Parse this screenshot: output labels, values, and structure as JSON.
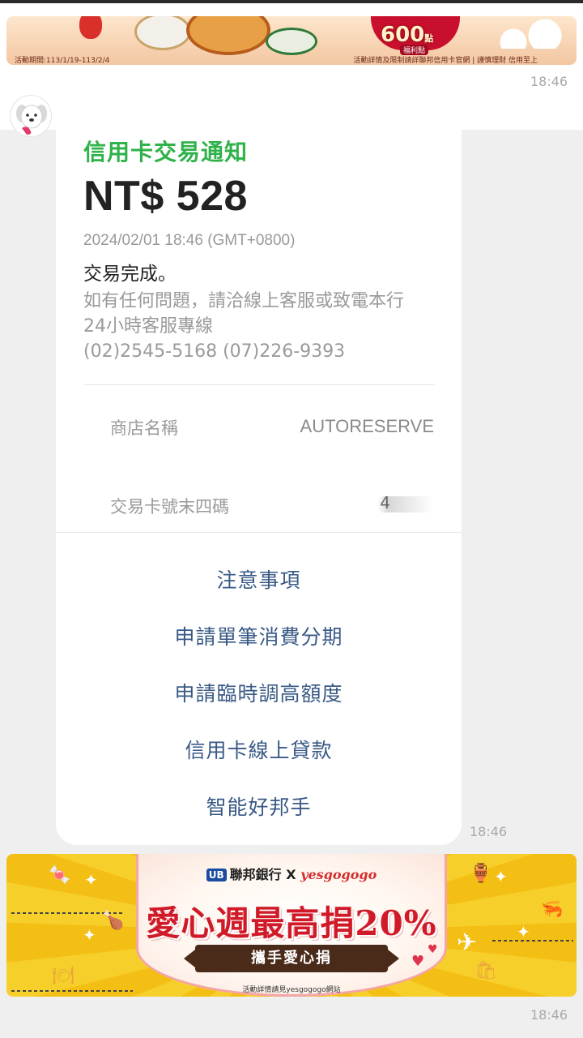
{
  "top_banner": {
    "period_text": "活動期間:113/1/19-113/2/4",
    "points_value": "600",
    "points_unit": "點",
    "points_sub": "福利點",
    "disclaimer_text": "活動詳情及限制請詳聯邦信用卡官網 | 謹慎理財 信用至上"
  },
  "timestamps": {
    "top_banner_time": "18:46",
    "card_time": "18:46",
    "bottom_banner_time": "18:46"
  },
  "notification": {
    "title": "信用卡交易通知",
    "amount": "NT$ 528",
    "datetime": "2024/02/01 18:46 (GMT+0800)",
    "status": "交易完成。",
    "note_line1": "如有任何問題，請洽線上客服或致電本行",
    "note_line2": "24小時客服專線",
    "note_line3": "(02)2545-5168 (07)226-9393",
    "merchant_label": "商店名稱",
    "merchant_value": "AUTORESERVE",
    "card_last4_label": "交易卡號末四碼",
    "card_last4_value": "4"
  },
  "actions": [
    {
      "label": "注意事項"
    },
    {
      "label": "申請單筆消費分期"
    },
    {
      "label": "申請臨時調高額度"
    },
    {
      "label": "信用卡線上貸款"
    },
    {
      "label": "智能好邦手"
    }
  ],
  "bottom_banner": {
    "brand_logo": "UB",
    "brand_name": "聯邦銀行",
    "cross": "X",
    "partner": "yesgogogo",
    "headline": "愛心週最高捐20%",
    "button_label": "攜手愛心捐",
    "footer": "活動詳情請見yesgogogo網站"
  },
  "colors": {
    "title_green": "#2fb24a",
    "action_blue": "#3a5a86",
    "banner_yellow": "#f7cf2a",
    "headline_red": "#d11a28"
  }
}
